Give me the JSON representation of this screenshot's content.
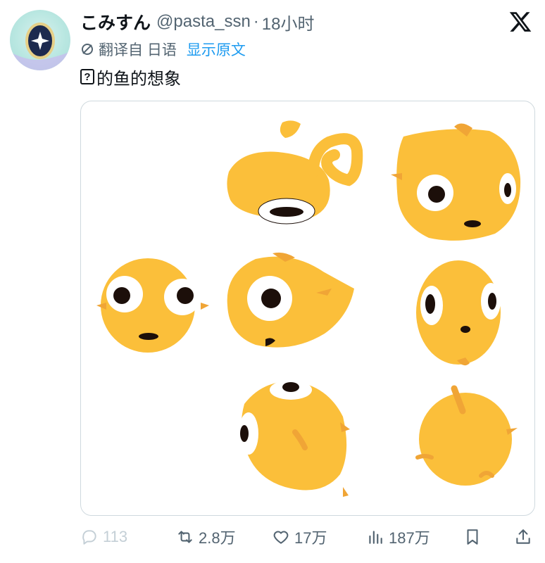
{
  "author": {
    "display_name": "こみすん",
    "handle": "@pasta_ssn",
    "separator": "·",
    "time": "18小时"
  },
  "icons": {
    "avatar": "avatar-icon",
    "x_logo": "x-logo-icon",
    "translate": "translate-icon",
    "reply": "reply-icon",
    "retweet": "retweet-icon",
    "like": "heart-icon",
    "views": "views-chart-icon",
    "bookmark": "bookmark-icon",
    "share": "share-icon"
  },
  "translation": {
    "label": "翻译自 日语",
    "show_original": "显示原文"
  },
  "tweet": {
    "text_box": "?",
    "text": "的鱼的想象"
  },
  "media": {
    "description": "sketches"
  },
  "stats": {
    "replies": "113",
    "retweets": "2.8万",
    "likes": "17万",
    "views": "187万"
  },
  "colors": {
    "link": "#1d9bf0",
    "muted": "#536471",
    "fish": "#fbbf3a",
    "fin": "#f0a536"
  }
}
